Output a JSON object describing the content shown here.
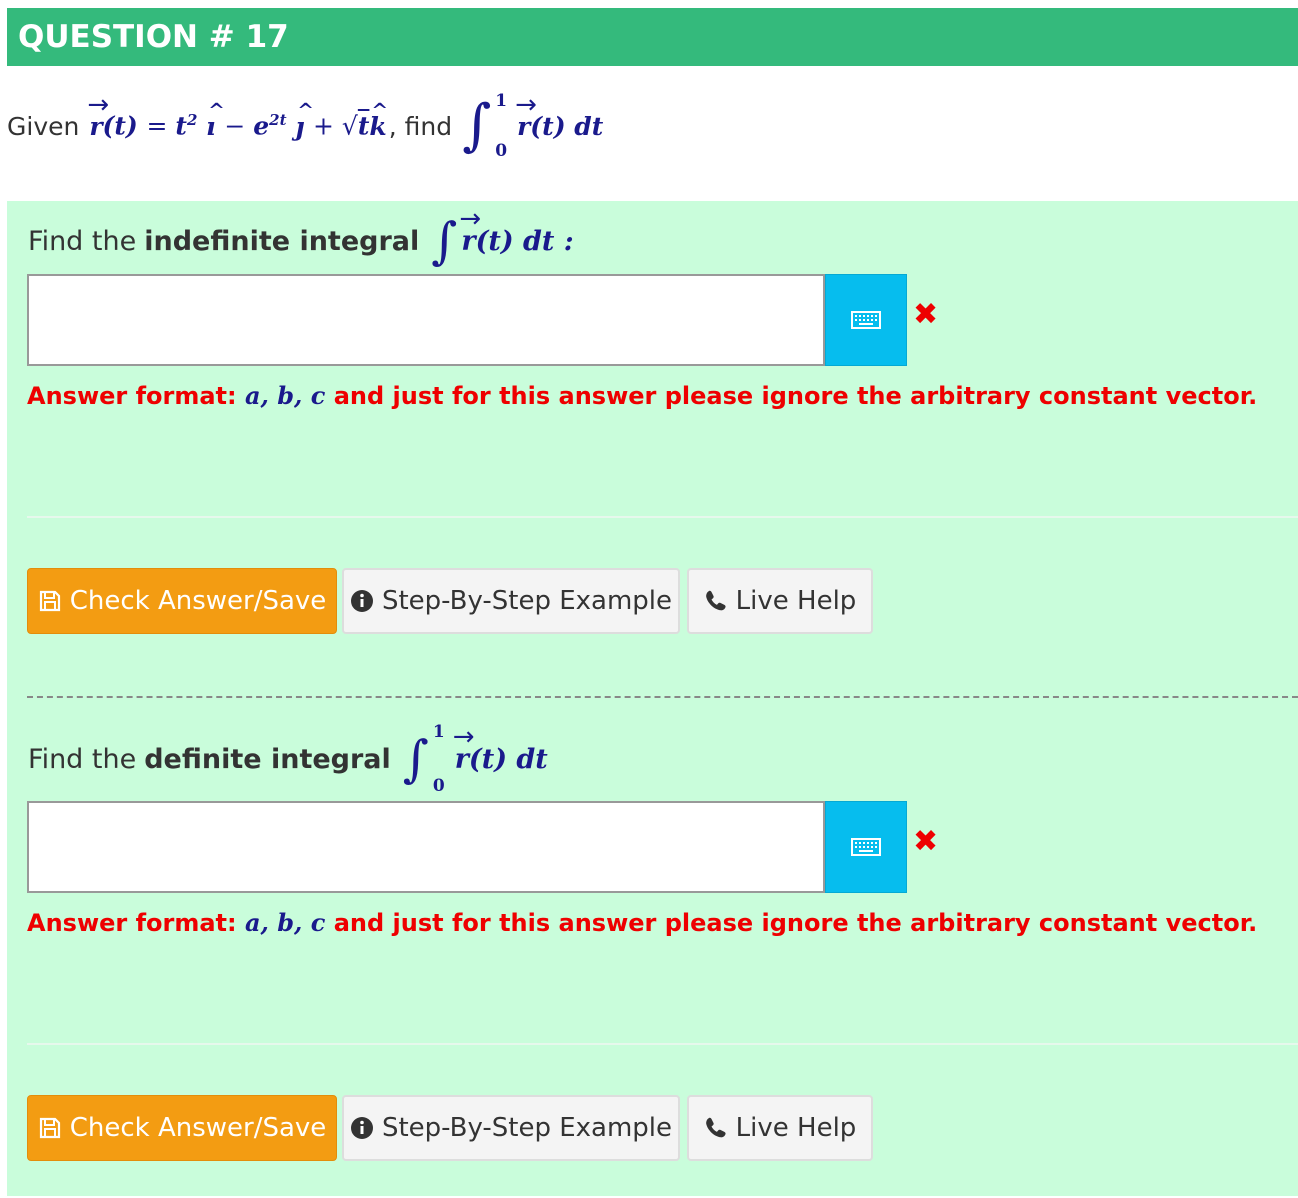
{
  "header": {
    "title": "QUESTION # 17"
  },
  "problem": {
    "given_word": "Given",
    "find_word": ", find",
    "function_text": "r(t) = t² î − e²ᵗ ĵ + √t k̂",
    "integral_upper": "1",
    "integral_lower": "0",
    "integrand": "r(t) dt"
  },
  "parts": [
    {
      "prompt_prefix": "Find the",
      "prompt_bold": "indefinite integral",
      "prompt_math": "r(t) dt :",
      "answer_value": "",
      "format_prefix": "Answer format:",
      "format_math": "a, b, c",
      "format_suffix": "and just for this answer please ignore the arbitrary constant vector."
    },
    {
      "prompt_prefix": "Find the",
      "prompt_bold": "definite integral",
      "prompt_math": "r(t) dt",
      "upper": "1",
      "lower": "0",
      "answer_value": "",
      "format_prefix": "Answer format:",
      "format_math": "a, b, c",
      "format_suffix": "and just for this answer please ignore the arbitrary constant vector."
    }
  ],
  "buttons": {
    "check": "Check Answer/Save",
    "step": "Step-By-Step Example",
    "help": "Live Help"
  },
  "colors": {
    "header": "#34ba7c",
    "panel": "#c9fddb",
    "check_button": "#f39c12",
    "keyboard_button": "#06bdee",
    "error": "#ee0000"
  },
  "icons": [
    "floppy-save-icon",
    "info-circle-icon",
    "phone-icon",
    "keyboard-icon",
    "wrong-x-icon"
  ]
}
